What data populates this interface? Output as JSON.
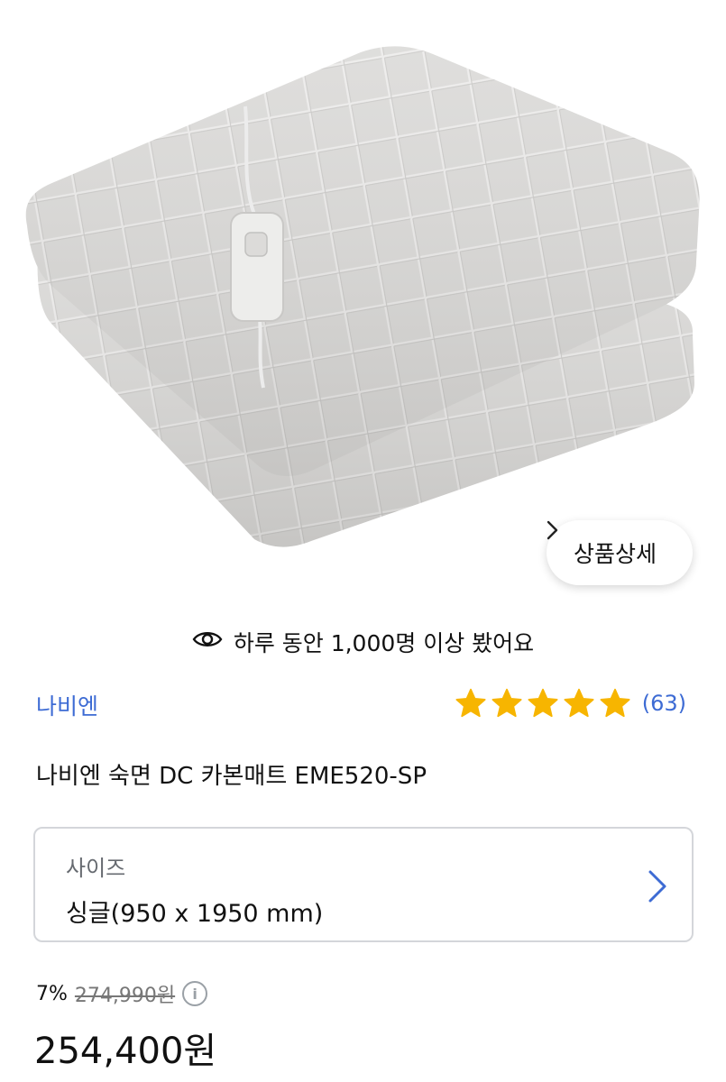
{
  "product_image": {
    "description_icon": "heated-mat-image"
  },
  "detail_button": {
    "label": "상품상세",
    "icon": "chevron-right-icon"
  },
  "viewers": {
    "icon": "eye-icon",
    "text": "하루 동안 1,000명 이상 봤어요"
  },
  "brand": {
    "name": "나비엔"
  },
  "rating": {
    "stars": 5,
    "count": "(63)",
    "star_color": "#f7b500"
  },
  "product": {
    "title": "나비엔 숙면 DC 카본매트 EME520-SP"
  },
  "option": {
    "label": "사이즈",
    "value": "싱글(950 x 1950 mm)",
    "icon": "chevron-right-icon"
  },
  "price": {
    "discount": "7%",
    "original": "274,990원",
    "info_icon": "info-icon",
    "final": "254,400원"
  },
  "colors": {
    "accent": "#3d6bd4",
    "border": "#d4d6da"
  }
}
